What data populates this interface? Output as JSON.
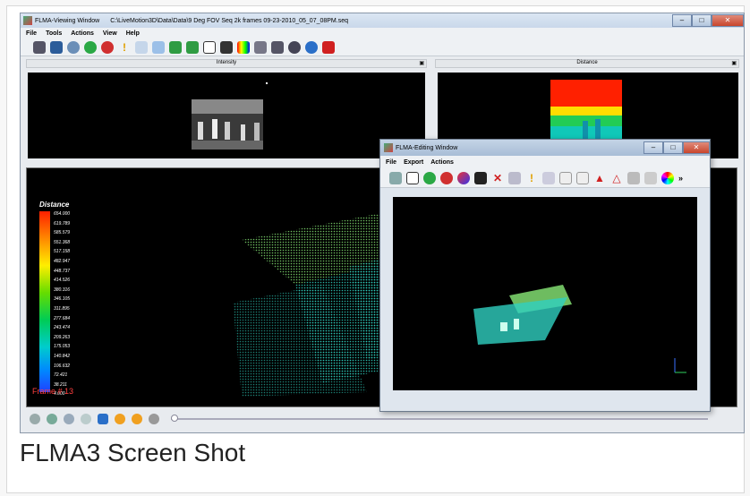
{
  "main_window": {
    "title": "FLMA-Viewing Window",
    "path": "C:\\LiveMotion3D\\Data\\Data\\9 Deg FOV Seq 2k frames 09-23-2010_05_07_08PM.seq",
    "menu": [
      "File",
      "Tools",
      "Actions",
      "View",
      "Help"
    ],
    "panels": {
      "left_label": "Intensity",
      "right_label": "Distance"
    },
    "legend": {
      "title": "Distance",
      "values": [
        "654.000",
        "619.789",
        "585.579",
        "551.368",
        "517.158",
        "482.947",
        "448.737",
        "414.526",
        "380.316",
        "346.105",
        "311.895",
        "277.684",
        "243.474",
        "209.263",
        "175.053",
        "140.842",
        "106.632",
        "72.421",
        "38.211",
        "4.000"
      ]
    },
    "frame_label": "Frame # 13"
  },
  "edit_window": {
    "title": "FLMA-Editing Window",
    "menu": [
      "File",
      "Export",
      "Actions"
    ],
    "more": "»"
  },
  "caption": "FLMA3 Screen Shot",
  "colors": {
    "accent": "#3a78c3",
    "cloud": "#2fd0c0",
    "red": "#ff2000"
  }
}
